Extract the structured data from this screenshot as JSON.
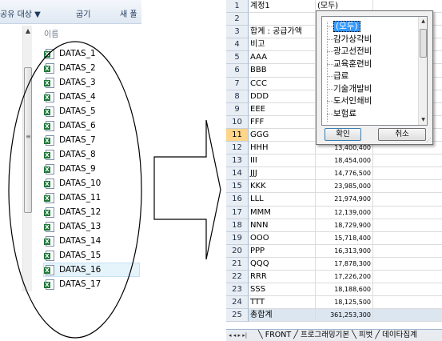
{
  "explorer": {
    "toolbar": {
      "share": "공유 대상 ▼",
      "burn": "굽기",
      "new_folder": "새 폴"
    },
    "column_header": "이름",
    "files": [
      "DATAS_1",
      "DATAS_2",
      "DATAS_3",
      "DATAS_4",
      "DATAS_5",
      "DATAS_6",
      "DATAS_7",
      "DATAS_8",
      "DATAS_9",
      "DATAS_10",
      "DATAS_11",
      "DATAS_12",
      "DATAS_13",
      "DATAS_14",
      "DATAS_15",
      "DATAS_16",
      "DATAS_17"
    ],
    "selected_file": "DATAS_16"
  },
  "sheet": {
    "row_numbers": [
      "1",
      "2",
      "3",
      "4",
      "5",
      "6",
      "7",
      "8",
      "9",
      "10",
      "11",
      "12",
      "13",
      "14",
      "15",
      "16",
      "17",
      "18",
      "19",
      "20",
      "21",
      "22",
      "23",
      "24",
      "25"
    ],
    "highlighted_row": "11",
    "col_a": [
      "계정1",
      "",
      "합계 : 공급가액",
      "비고",
      "AAA",
      "BBB",
      "CCC",
      "DDD",
      "EEE",
      "FFF",
      "GGG",
      "HHH",
      "III",
      "JJJ",
      "KKK",
      "LLL",
      "MMM",
      "NNN",
      "OOO",
      "PPP",
      "QQQ",
      "RRR",
      "SSS",
      "TTT",
      "총합계"
    ],
    "col_b": [
      "(모두)",
      "",
      "",
      "",
      "",
      "",
      "",
      "",
      "",
      "",
      "",
      "13,400,400",
      "18,454,000",
      "14,776,500",
      "23,985,000",
      "21,974,900",
      "12,139,000",
      "18,729,900",
      "15,718,400",
      "16,313,900",
      "17,878,300",
      "17,226,200",
      "18,188,600",
      "18,125,500",
      "361,253,300"
    ],
    "tab_nav": "◂ ◂ ▸ ▸|",
    "tabs": "╲ FRONT ╱ 프로그래밍기본 ╲ 피벗 ╱ 데이타집계"
  },
  "filter_dropdown": {
    "options": [
      "(모두)",
      "감가상각비",
      "광고선전비",
      "교육훈련비",
      "급료",
      "기술개발비",
      "도서인쇄비",
      "보험료"
    ],
    "ok_label": "확인",
    "cancel_label": "취소"
  },
  "colors": {
    "ellipse": "#000000",
    "accent": "#3399ff",
    "excel_green": "#1f7a3a"
  }
}
